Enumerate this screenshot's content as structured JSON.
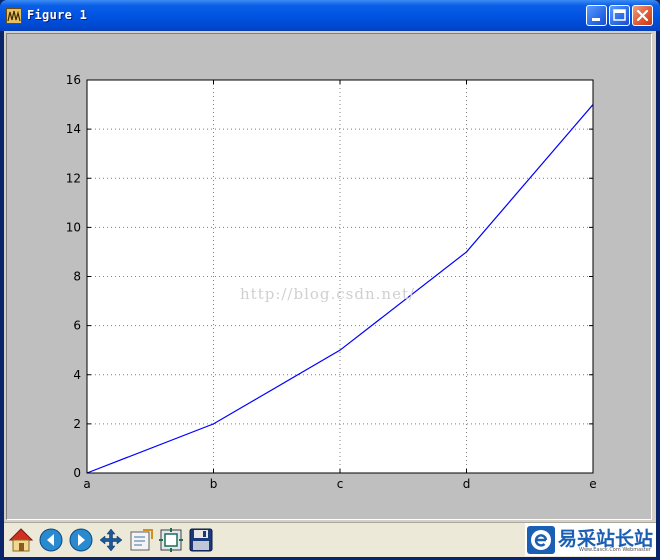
{
  "window": {
    "title": "Figure 1",
    "app_icon": "matplotlib-figure-icon",
    "buttons": {
      "minimize": "minimize-icon",
      "maximize": "maximize-icon",
      "close": "close-icon"
    }
  },
  "toolbar": {
    "tools": [
      {
        "name": "home",
        "icon": "home-icon"
      },
      {
        "name": "back",
        "icon": "arrow-left-icon"
      },
      {
        "name": "forward",
        "icon": "arrow-right-icon"
      },
      {
        "name": "pan",
        "icon": "move-arrows-icon"
      },
      {
        "name": "zoom",
        "icon": "zoom-rect-icon"
      },
      {
        "name": "subplots",
        "icon": "subplots-config-icon"
      },
      {
        "name": "save",
        "icon": "floppy-disk-icon"
      }
    ]
  },
  "watermark": {
    "blog_url": "http://blog.csdn.net/",
    "logo_text": "易采站长站",
    "logo_sub": "Www.Easck.Com  Webmaster"
  },
  "colors": {
    "line": "#0000ff",
    "canvas_bg": "#bfbfbf",
    "plot_bg": "#ffffff",
    "grid": "#7f7f7f"
  },
  "chart_data": {
    "type": "line",
    "categories": [
      "a",
      "b",
      "c",
      "d",
      "e"
    ],
    "series": [
      {
        "values": [
          0,
          2,
          5,
          9,
          15
        ]
      }
    ],
    "yticks": [
      "0",
      "2",
      "4",
      "6",
      "8",
      "10",
      "12",
      "14",
      "16"
    ],
    "ylim": [
      0,
      16
    ],
    "grid": true,
    "title": "",
    "xlabel": "",
    "ylabel": ""
  }
}
